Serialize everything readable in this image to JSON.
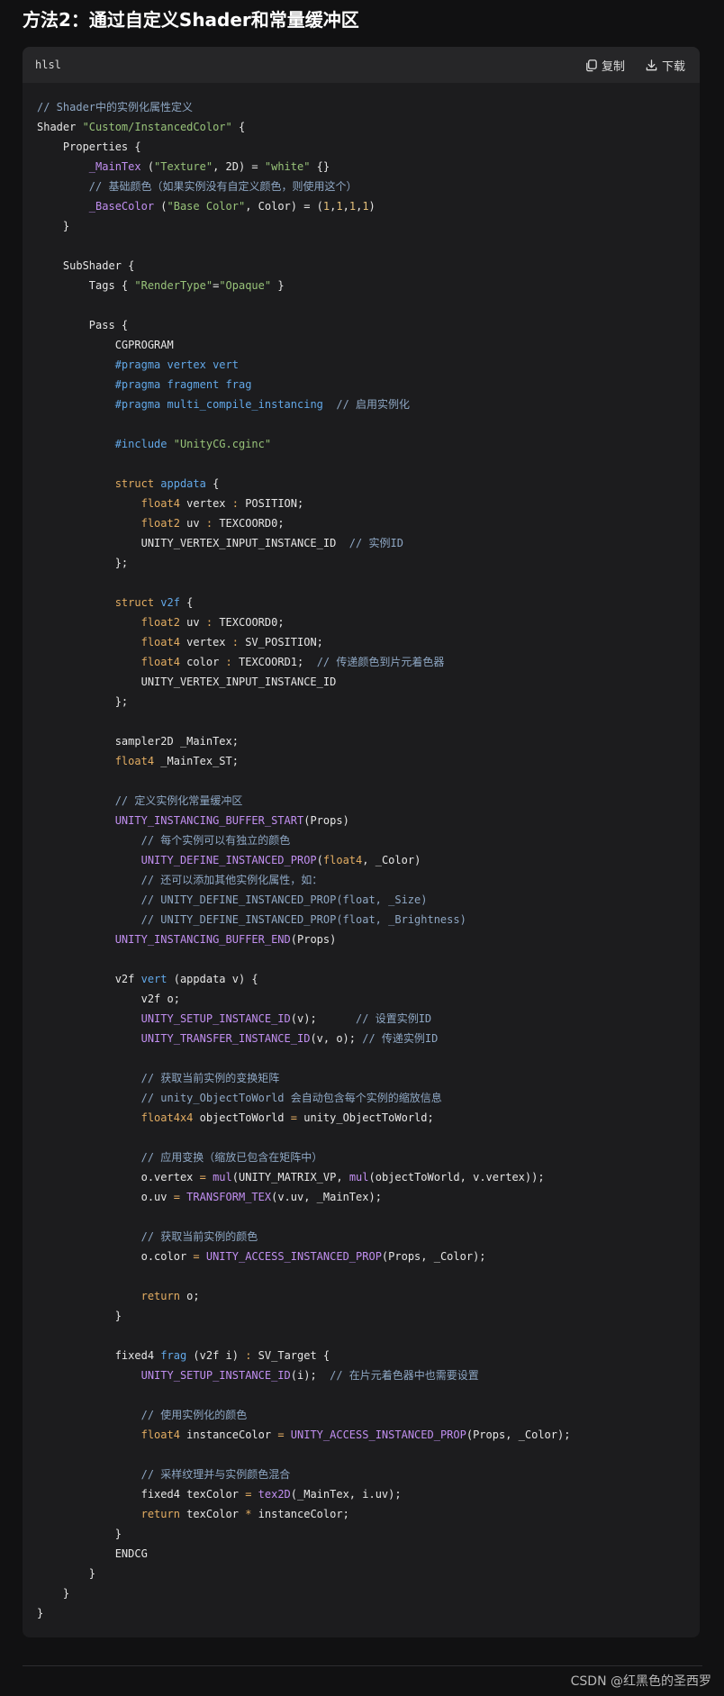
{
  "heading": "方法2：通过自定义Shader和常量缓冲区",
  "code_block": {
    "language": "hlsl",
    "copy_label": "复制",
    "download_label": "下载",
    "copy_icon": "copy-icon",
    "download_icon": "download-icon",
    "lines": [
      [
        [
          "cm",
          "// Shader中的实例化属性定义"
        ]
      ],
      [
        [
          "",
          "Shader "
        ],
        [
          "str",
          "\"Custom/InstancedColor\""
        ],
        [
          "",
          " {"
        ]
      ],
      [
        [
          "",
          "    Properties {"
        ]
      ],
      [
        [
          "fn",
          "        _MainTex"
        ],
        [
          "",
          " ("
        ],
        [
          "str",
          "\"Texture\""
        ],
        [
          "",
          ", 2D) = "
        ],
        [
          "str",
          "\"white\""
        ],
        [
          "",
          " {}"
        ]
      ],
      [
        [
          "cm",
          "        // 基础颜色（如果实例没有自定义颜色，则使用这个）"
        ]
      ],
      [
        [
          "fn",
          "        _BaseColor"
        ],
        [
          "",
          " ("
        ],
        [
          "str",
          "\"Base Color\""
        ],
        [
          "",
          ", Color) = ("
        ],
        [
          "num",
          "1"
        ],
        [
          "",
          ","
        ],
        [
          "num",
          "1"
        ],
        [
          "",
          ","
        ],
        [
          "num",
          "1"
        ],
        [
          "",
          ","
        ],
        [
          "num",
          "1"
        ],
        [
          "",
          ")"
        ]
      ],
      [
        [
          "",
          "    }"
        ]
      ],
      [
        [
          "",
          ""
        ]
      ],
      [
        [
          "",
          "    SubShader {"
        ]
      ],
      [
        [
          "",
          "        Tags { "
        ],
        [
          "str",
          "\"RenderType\""
        ],
        [
          "",
          "="
        ],
        [
          "str",
          "\"Opaque\""
        ],
        [
          "",
          " }"
        ]
      ],
      [
        [
          "",
          ""
        ]
      ],
      [
        [
          "",
          "        Pass {"
        ]
      ],
      [
        [
          "",
          "            CGPROGRAM"
        ]
      ],
      [
        [
          "pp",
          "            #pragma"
        ],
        [
          "fnn",
          " vertex vert"
        ]
      ],
      [
        [
          "pp",
          "            #pragma"
        ],
        [
          "fnn",
          " fragment frag"
        ]
      ],
      [
        [
          "pp",
          "            #pragma"
        ],
        [
          "fnn",
          " multi_compile_instancing"
        ],
        [
          "cm",
          "  // 启用实例化"
        ]
      ],
      [
        [
          "",
          ""
        ]
      ],
      [
        [
          "pp",
          "            #include"
        ],
        [
          "str",
          " \"UnityCG.cginc\""
        ]
      ],
      [
        [
          "",
          ""
        ]
      ],
      [
        [
          "kw",
          "            struct"
        ],
        [
          "fnn",
          " appdata"
        ],
        [
          "",
          " {"
        ]
      ],
      [
        [
          "ty",
          "                float4"
        ],
        [
          "",
          " vertex "
        ],
        [
          "op",
          ":"
        ],
        [
          "",
          " POSITION;"
        ]
      ],
      [
        [
          "ty",
          "                float2"
        ],
        [
          "",
          " uv "
        ],
        [
          "op",
          ":"
        ],
        [
          "",
          " TEXCOORD0;"
        ]
      ],
      [
        [
          "",
          "                UNITY_VERTEX_INPUT_INSTANCE_ID"
        ],
        [
          "cm",
          "  // 实例ID"
        ]
      ],
      [
        [
          "",
          "            };"
        ]
      ],
      [
        [
          "",
          ""
        ]
      ],
      [
        [
          "kw",
          "            struct"
        ],
        [
          "fnn",
          " v2f"
        ],
        [
          "",
          " {"
        ]
      ],
      [
        [
          "ty",
          "                float2"
        ],
        [
          "",
          " uv "
        ],
        [
          "op",
          ":"
        ],
        [
          "",
          " TEXCOORD0;"
        ]
      ],
      [
        [
          "ty",
          "                float4"
        ],
        [
          "",
          " vertex "
        ],
        [
          "op",
          ":"
        ],
        [
          "",
          " SV_POSITION;"
        ]
      ],
      [
        [
          "ty",
          "                float4"
        ],
        [
          "",
          " color "
        ],
        [
          "op",
          ":"
        ],
        [
          "",
          " TEXCOORD1;"
        ],
        [
          "cm",
          "  // 传递颜色到片元着色器"
        ]
      ],
      [
        [
          "",
          "                UNITY_VERTEX_INPUT_INSTANCE_ID"
        ]
      ],
      [
        [
          "",
          "            };"
        ]
      ],
      [
        [
          "",
          ""
        ]
      ],
      [
        [
          "",
          "            sampler2D _MainTex;"
        ]
      ],
      [
        [
          "ty",
          "            float4"
        ],
        [
          "",
          " _MainTex_ST;"
        ]
      ],
      [
        [
          "",
          ""
        ]
      ],
      [
        [
          "cm",
          "            // 定义实例化常量缓冲区"
        ]
      ],
      [
        [
          "mc",
          "            UNITY_INSTANCING_BUFFER_START"
        ],
        [
          "",
          "(Props)"
        ]
      ],
      [
        [
          "cm",
          "                // 每个实例可以有独立的颜色"
        ]
      ],
      [
        [
          "mc",
          "                UNITY_DEFINE_INSTANCED_PROP"
        ],
        [
          "",
          "("
        ],
        [
          "ty",
          "float4"
        ],
        [
          "",
          ", _Color)"
        ]
      ],
      [
        [
          "cm",
          "                // 还可以添加其他实例化属性，如："
        ]
      ],
      [
        [
          "cm",
          "                // UNITY_DEFINE_INSTANCED_PROP(float, _Size)"
        ]
      ],
      [
        [
          "cm",
          "                // UNITY_DEFINE_INSTANCED_PROP(float, _Brightness)"
        ]
      ],
      [
        [
          "mc",
          "            UNITY_INSTANCING_BUFFER_END"
        ],
        [
          "",
          "(Props)"
        ]
      ],
      [
        [
          "",
          ""
        ]
      ],
      [
        [
          "",
          "            v2f "
        ],
        [
          "fnn",
          "vert"
        ],
        [
          "",
          " (appdata v) {"
        ]
      ],
      [
        [
          "",
          "                v2f o;"
        ]
      ],
      [
        [
          "mc",
          "                UNITY_SETUP_INSTANCE_ID"
        ],
        [
          "",
          "(v);"
        ],
        [
          "cm",
          "      // 设置实例ID"
        ]
      ],
      [
        [
          "mc",
          "                UNITY_TRANSFER_INSTANCE_ID"
        ],
        [
          "",
          "(v, o);"
        ],
        [
          "cm",
          " // 传递实例ID"
        ]
      ],
      [
        [
          "",
          ""
        ]
      ],
      [
        [
          "cm",
          "                // 获取当前实例的变换矩阵"
        ]
      ],
      [
        [
          "cm",
          "                // unity_ObjectToWorld 会自动包含每个实例的缩放信息"
        ]
      ],
      [
        [
          "ty",
          "                float4x4"
        ],
        [
          "",
          " objectToWorld "
        ],
        [
          "op",
          "="
        ],
        [
          "",
          " unity_ObjectToWorld;"
        ]
      ],
      [
        [
          "",
          ""
        ]
      ],
      [
        [
          "cm",
          "                // 应用变换（缩放已包含在矩阵中）"
        ]
      ],
      [
        [
          "",
          "                o.vertex "
        ],
        [
          "op",
          "="
        ],
        [
          "mc",
          " mul"
        ],
        [
          "",
          "(UNITY_MATRIX_VP, "
        ],
        [
          "mc",
          "mul"
        ],
        [
          "",
          "(objectToWorld, v.vertex));"
        ]
      ],
      [
        [
          "",
          "                o.uv "
        ],
        [
          "op",
          "="
        ],
        [
          "mc",
          " TRANSFORM_TEX"
        ],
        [
          "",
          "(v.uv, _MainTex);"
        ]
      ],
      [
        [
          "",
          ""
        ]
      ],
      [
        [
          "cm",
          "                // 获取当前实例的颜色"
        ]
      ],
      [
        [
          "",
          "                o.color "
        ],
        [
          "op",
          "="
        ],
        [
          "mc",
          " UNITY_ACCESS_INSTANCED_PROP"
        ],
        [
          "",
          "(Props, _Color);"
        ]
      ],
      [
        [
          "",
          ""
        ]
      ],
      [
        [
          "kw",
          "                return"
        ],
        [
          "",
          " o;"
        ]
      ],
      [
        [
          "",
          "            }"
        ]
      ],
      [
        [
          "",
          ""
        ]
      ],
      [
        [
          "",
          "            fixed4 "
        ],
        [
          "fnn",
          "frag"
        ],
        [
          "",
          " (v2f i) "
        ],
        [
          "op",
          ":"
        ],
        [
          "",
          " SV_Target {"
        ]
      ],
      [
        [
          "mc",
          "                UNITY_SETUP_INSTANCE_ID"
        ],
        [
          "",
          "(i);"
        ],
        [
          "cm",
          "  // 在片元着色器中也需要设置"
        ]
      ],
      [
        [
          "",
          ""
        ]
      ],
      [
        [
          "cm",
          "                // 使用实例化的颜色"
        ]
      ],
      [
        [
          "ty",
          "                float4"
        ],
        [
          "",
          " instanceColor "
        ],
        [
          "op",
          "="
        ],
        [
          "mc",
          " UNITY_ACCESS_INSTANCED_PROP"
        ],
        [
          "",
          "(Props, _Color);"
        ]
      ],
      [
        [
          "",
          ""
        ]
      ],
      [
        [
          "cm",
          "                // 采样纹理并与实例颜色混合"
        ]
      ],
      [
        [
          "",
          "                fixed4 texColor "
        ],
        [
          "op",
          "="
        ],
        [
          "mc",
          " tex2D"
        ],
        [
          "",
          "(_MainTex, i.uv);"
        ]
      ],
      [
        [
          "kw",
          "                return"
        ],
        [
          "",
          " texColor "
        ],
        [
          "op",
          "*"
        ],
        [
          "",
          " instanceColor;"
        ]
      ],
      [
        [
          "",
          "            }"
        ]
      ],
      [
        [
          "",
          "            ENDCG"
        ]
      ],
      [
        [
          "",
          "        }"
        ]
      ],
      [
        [
          "",
          "    }"
        ]
      ],
      [
        [
          "",
          "}"
        ]
      ]
    ]
  },
  "footer": "CSDN @红黑色的圣西罗"
}
